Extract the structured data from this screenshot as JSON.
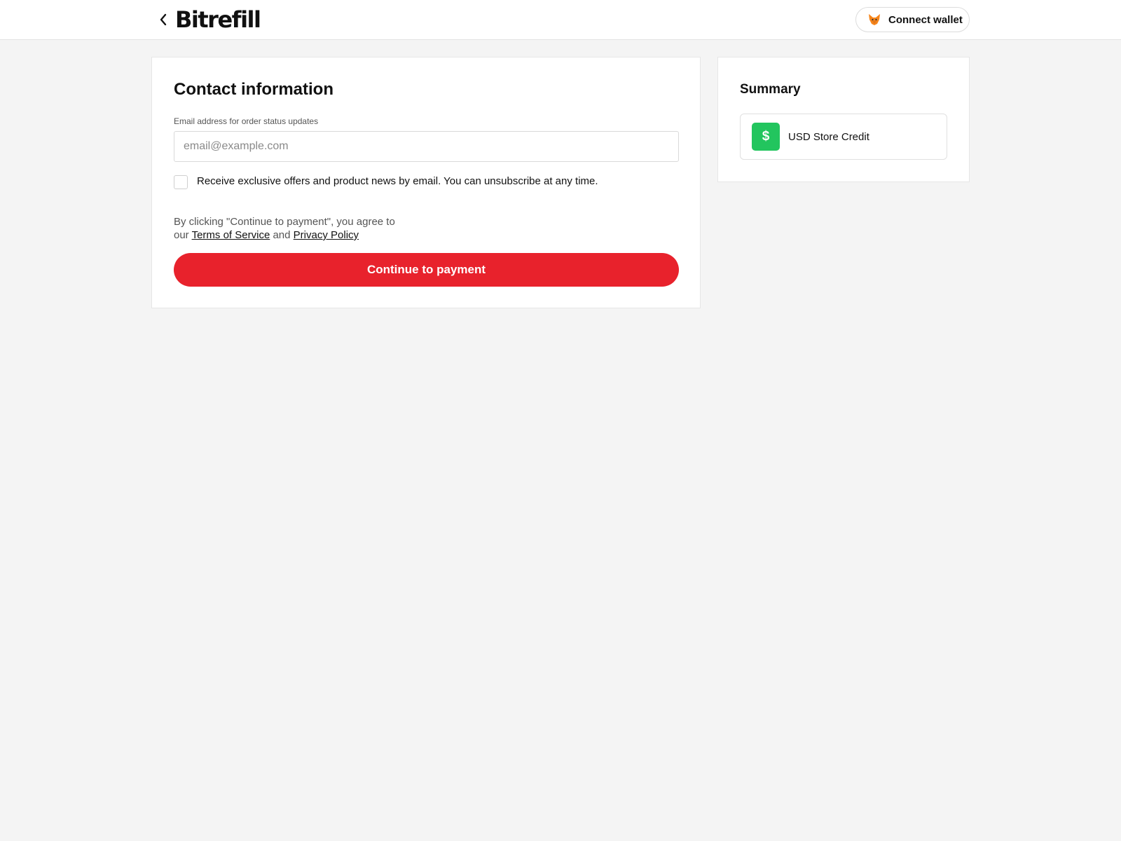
{
  "header": {
    "logo_text": "Bitrefill",
    "back_icon": "chevron-left-icon",
    "wallet_button_label": "Connect wallet",
    "wallet_icon": "fox-icon"
  },
  "contact": {
    "title": "Contact information",
    "email_label": "Email address for order status updates",
    "email_placeholder": "email@example.com",
    "email_value": "",
    "newsletter_label": "Receive exclusive offers and product news by email. You can unsubscribe at any time.",
    "newsletter_checked": false,
    "legal_prefix": "By clicking \"Continue to payment\", you agree to our",
    "terms_link": "Terms of Service",
    "legal_and": "and",
    "privacy_link": "Privacy Policy",
    "submit_label": "Continue to payment"
  },
  "summary": {
    "title": "Summary",
    "items": [
      {
        "icon": "dollar-icon",
        "icon_glyph": "$",
        "name": "USD Store Credit"
      }
    ]
  },
  "colors": {
    "accent": "#e8222c",
    "credit_icon_bg": "#22c55e",
    "page_bg": "#f4f4f4"
  }
}
